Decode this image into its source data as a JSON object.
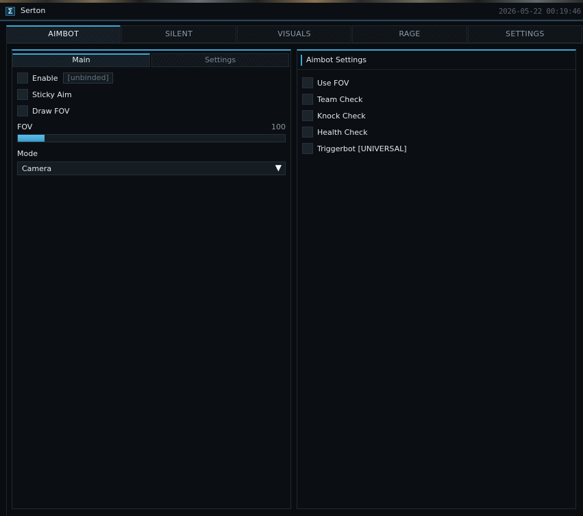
{
  "window": {
    "title": "Serton",
    "logo_glyph": "Σ",
    "datetime": "2026-05-22 00:19:46"
  },
  "tabs": [
    {
      "label": "AIMBOT",
      "active": true
    },
    {
      "label": "SILENT",
      "active": false
    },
    {
      "label": "VISUALS",
      "active": false
    },
    {
      "label": "RAGE",
      "active": false
    },
    {
      "label": "SETTINGS",
      "active": false
    }
  ],
  "left_panel": {
    "subtabs": [
      {
        "label": "Main",
        "active": true
      },
      {
        "label": "Settings",
        "active": false
      }
    ],
    "enable": {
      "label": "Enable",
      "keybind": "[unbinded]",
      "checked": false
    },
    "sticky_aim": {
      "label": "Sticky Aim",
      "checked": false
    },
    "draw_fov": {
      "label": "Draw FOV",
      "checked": false
    },
    "fov": {
      "label": "FOV",
      "value": "100",
      "fill_fraction": 0.1
    },
    "mode": {
      "label": "Mode",
      "selected": "Camera",
      "caret": "▼"
    }
  },
  "right_panel": {
    "header": "Aimbot Settings",
    "options": [
      {
        "label": "Use FOV",
        "checked": false
      },
      {
        "label": "Team Check",
        "checked": false
      },
      {
        "label": "Knock Check",
        "checked": false
      },
      {
        "label": "Health Check",
        "checked": false
      },
      {
        "label": "Triggerbot [UNIVERSAL]",
        "checked": false
      }
    ]
  },
  "colors": {
    "accent": "#3ea8d6",
    "background": "#0a0d10",
    "panel": "#0b0f13"
  }
}
